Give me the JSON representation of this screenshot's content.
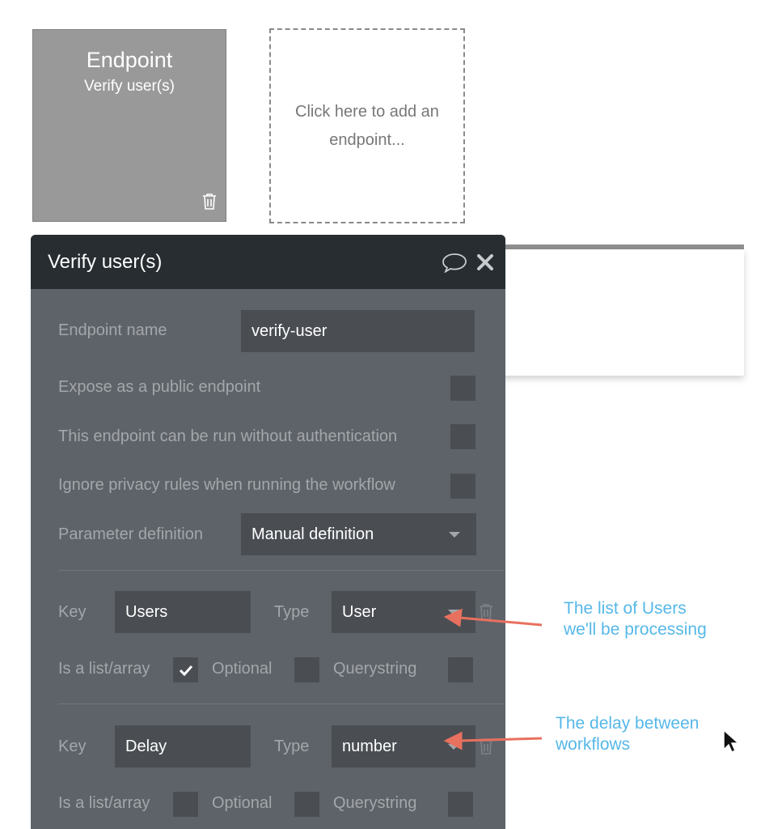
{
  "canvas": {
    "endpoint_card": {
      "title": "Endpoint",
      "subtitle": "Verify user(s)",
      "icon": "trash-icon"
    },
    "add_card": {
      "text": "Click here to add an endpoint..."
    }
  },
  "panel": {
    "title": "Verify user(s)",
    "icons": [
      "comment-icon",
      "close-icon"
    ],
    "fields": {
      "endpoint_name": {
        "label": "Endpoint name",
        "value": "verify-user"
      },
      "expose_public": {
        "label": "Expose as a public endpoint",
        "checked": false
      },
      "no_auth": {
        "label": "This endpoint can be run without authentication",
        "checked": false
      },
      "ignore_privacy": {
        "label": "Ignore privacy rules when running the workflow",
        "checked": false
      },
      "parameter_definition": {
        "label": "Parameter definition",
        "value": "Manual definition"
      }
    },
    "parameters": [
      {
        "key_label": "Key",
        "key_value": "Users",
        "type_label": "Type",
        "type_value": "User",
        "list_label": "Is a list/array",
        "list_checked": true,
        "optional_label": "Optional",
        "optional_checked": false,
        "querystring_label": "Querystring",
        "querystring_checked": false
      },
      {
        "key_label": "Key",
        "key_value": "Delay",
        "type_label": "Type",
        "type_value": "number",
        "list_label": "Is a list/array",
        "list_checked": false,
        "optional_label": "Optional",
        "optional_checked": false,
        "querystring_label": "Querystring",
        "querystring_checked": false
      }
    ]
  },
  "annotations": [
    {
      "lines": [
        "The list of Users",
        "we'll be processing"
      ]
    },
    {
      "lines": [
        "The delay between",
        "workflows"
      ]
    }
  ],
  "colors": {
    "panel_bg": "#5e6369",
    "header_bg": "#272d31",
    "input_bg": "#4a4e53",
    "label": "#a3a7ab",
    "annotation": "#56b8e8",
    "arrow": "#e8705f"
  }
}
